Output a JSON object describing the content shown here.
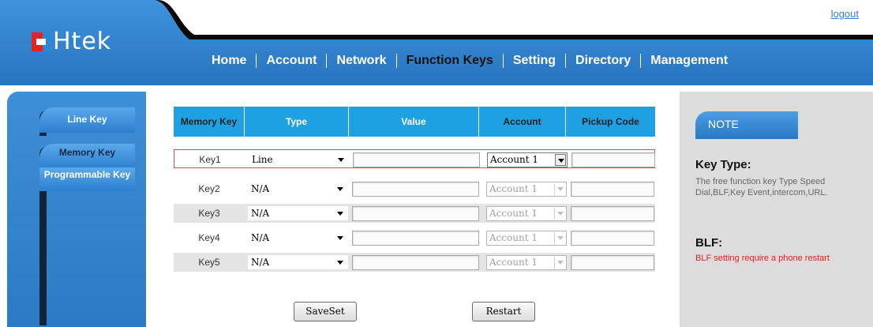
{
  "header": {
    "logout_label": "logout",
    "logo_text": "Htek",
    "nav": [
      "Home",
      "Account",
      "Network",
      "Function Keys",
      "Setting",
      "Directory",
      "Management"
    ],
    "active_nav": "Function Keys"
  },
  "sidebar": {
    "items": [
      "Line Key",
      "Memory Key",
      "Programmable Key"
    ],
    "active": "Memory Key"
  },
  "table": {
    "headers": [
      "Memory Key",
      "Type",
      "Value",
      "Account",
      "Pickup Code"
    ],
    "rows": [
      {
        "key": "Key1",
        "type": "Line",
        "value": "",
        "account": "Account 1",
        "pickup": "",
        "account_enabled": true
      },
      {
        "key": "Key2",
        "type": "N/A",
        "value": "",
        "account": "Account 1",
        "pickup": "",
        "account_enabled": false
      },
      {
        "key": "Key3",
        "type": "N/A",
        "value": "",
        "account": "Account 1",
        "pickup": "",
        "account_enabled": false
      },
      {
        "key": "Key4",
        "type": "N/A",
        "value": "",
        "account": "Account 1",
        "pickup": "",
        "account_enabled": false
      },
      {
        "key": "Key5",
        "type": "N/A",
        "value": "",
        "account": "Account 1",
        "pickup": "",
        "account_enabled": false
      }
    ]
  },
  "actions": {
    "save_label": "SaveSet",
    "restart_label": "Restart"
  },
  "note": {
    "tab_label": "NOTE",
    "key_type_heading": "Key Type:",
    "key_type_text": "The free function key Type Speed Dial,BLF,Key Event,intercom,URL.",
    "blf_heading": "BLF:",
    "blf_text": "BLF setting require a phone restart"
  },
  "colors": {
    "header_blue": "#2c7ac5",
    "table_header": "#1da1e3",
    "warning_red": "#e2231a"
  }
}
